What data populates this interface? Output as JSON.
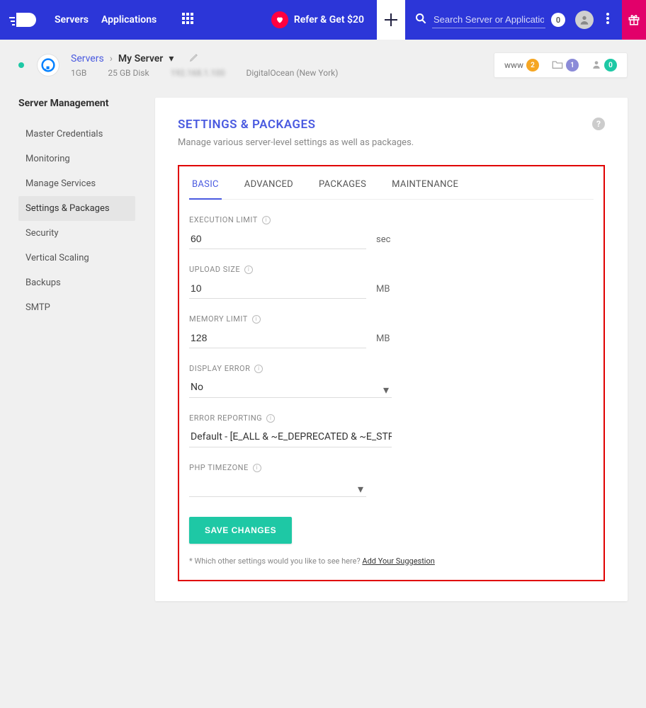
{
  "nav": {
    "links": [
      "Servers",
      "Applications"
    ],
    "refer_label": "Refer & Get $20",
    "search_placeholder": "Search Server or Application",
    "notif_count": "0"
  },
  "breadcrumb": {
    "servers_label": "Servers",
    "server_name": "My Server",
    "ram": "1GB",
    "disk": "25 GB Disk",
    "ip_masked": "192.168.1.100",
    "provider": "DigitalOcean (New York)"
  },
  "badges": {
    "www_label": "www",
    "www_count": "2",
    "folder_count": "1",
    "user_count": "0"
  },
  "sidebar": {
    "title": "Server Management",
    "items": [
      "Master Credentials",
      "Monitoring",
      "Manage Services",
      "Settings & Packages",
      "Security",
      "Vertical Scaling",
      "Backups",
      "SMTP"
    ],
    "active_index": 3
  },
  "panel": {
    "title": "SETTINGS & PACKAGES",
    "subtitle": "Manage various server-level settings as well as packages."
  },
  "tabs": [
    "BASIC",
    "ADVANCED",
    "PACKAGES",
    "MAINTENANCE"
  ],
  "active_tab": 0,
  "fields": {
    "execution_limit": {
      "label": "EXECUTION LIMIT",
      "value": "60",
      "unit": "sec"
    },
    "upload_size": {
      "label": "UPLOAD SIZE",
      "value": "10",
      "unit": "MB"
    },
    "memory_limit": {
      "label": "MEMORY LIMIT",
      "value": "128",
      "unit": "MB"
    },
    "display_error": {
      "label": "DISPLAY ERROR",
      "value": "No"
    },
    "error_reporting": {
      "label": "ERROR REPORTING",
      "value": "Default - [E_ALL & ~E_DEPRECATED & ~E_STRICT]"
    },
    "php_timezone": {
      "label": "PHP TIMEZONE",
      "value": ""
    }
  },
  "save_label": "SAVE CHANGES",
  "footnote_text": "* Which other settings would you like to see here? ",
  "footnote_link": "Add Your Suggestion"
}
